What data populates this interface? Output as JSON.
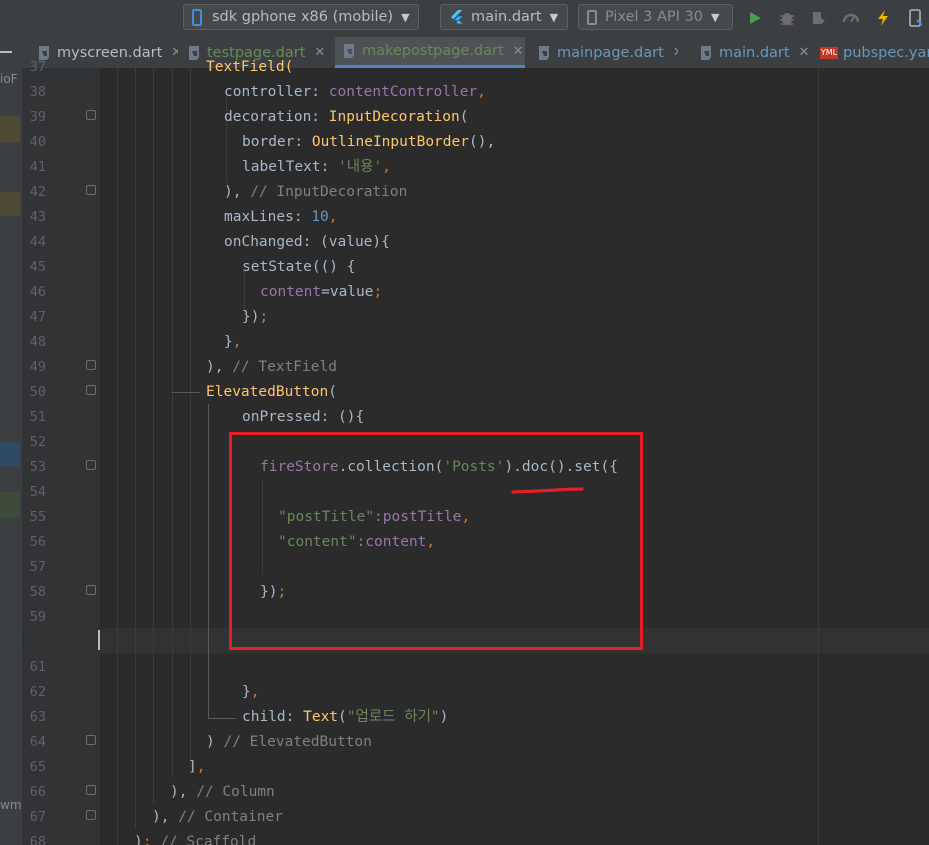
{
  "toolbar": {
    "device_selector": "sdk gphone x86 (mobile)",
    "run_config": "main.dart",
    "avd_selector": "Pixel 3 API 30",
    "icons": [
      "phone-icon",
      "flutter-icon",
      "device-icon",
      "run-icon",
      "debug-icon",
      "profile-icon",
      "coverage-icon",
      "hot-reload-icon",
      "device-manager-icon"
    ]
  },
  "tabs": [
    {
      "label": "myscreen.dart",
      "color": "#bbbbbb"
    },
    {
      "label": "testpage.dart",
      "color": "#6a8759"
    },
    {
      "label": "makepostpage.dart",
      "color": "#6a8759"
    },
    {
      "label": "mainpage.dart",
      "color": "#6897bb"
    },
    {
      "label": "main.dart",
      "color": "#6897bb"
    },
    {
      "label": "pubspec.yam",
      "color": "#6897bb"
    }
  ],
  "left_strip_labels": [
    "ioF",
    "wma"
  ],
  "line_numbers": [
    "37",
    "38",
    "39",
    "40",
    "41",
    "42",
    "43",
    "44",
    "45",
    "46",
    "47",
    "48",
    "49",
    "50",
    "51",
    "52",
    "53",
    "54",
    "55",
    "56",
    "57",
    "58",
    "59",
    "60",
    "61",
    "62",
    "63",
    "64",
    "65",
    "66",
    "67",
    "68"
  ],
  "current_line": "60",
  "code": {
    "l37": "TextField(",
    "l38_a": "controller: ",
    "l38_b": "contentController",
    "l38_c": ",",
    "l39_a": "decoration: ",
    "l39_b": "InputDecoration",
    "l39_c": "(",
    "l40_a": "border: ",
    "l40_b": "OutlineInputBorder",
    "l40_c": "(),",
    "l41_a": "labelText: ",
    "l41_b": "'내용'",
    "l41_c": ",",
    "l42_a": "), ",
    "l42_b": "// InputDecoration",
    "l43_a": "maxLines: ",
    "l43_b": "10",
    "l43_c": ",",
    "l44": "onChanged: (value){",
    "l45": "setState(() {",
    "l46_a": "content",
    "l46_b": "=value",
    "l46_c": ";",
    "l47_a": "})",
    "l47_b": ";",
    "l48_a": "}",
    "l48_b": ",",
    "l49_a": "), ",
    "l49_b": "// TextField",
    "l50_a": "ElevatedButton",
    "l50_b": "(",
    "l51": "onPressed: (){",
    "l53_a": "fireStore",
    "l53_b": ".collection(",
    "l53_c": "'Posts'",
    "l53_d": ").doc().set({",
    "l55_a": "\"postTitle\"",
    "l55_b": ":postTitle",
    "l55_c": ",",
    "l56_a": "\"content\"",
    "l56_b": ":content",
    "l56_c": ",",
    "l58_a": "})",
    "l58_b": ";",
    "l62_a": "}",
    "l62_b": ",",
    "l63_a": "child: ",
    "l63_b": "Text",
    "l63_c": "(",
    "l63_d": "\"업로드 하기\"",
    "l63_e": ")",
    "l64_a": ") ",
    "l64_b": "// ElevatedButton",
    "l65_a": "]",
    "l65_b": ",",
    "l66_a": "), ",
    "l66_b": "// Column",
    "l67_a": "), ",
    "l67_b": "// Container",
    "l68_a": ")",
    "l68_b": "; ",
    "l68_c": "// Scaffold"
  },
  "colors": {
    "annotation": "#e3202a",
    "keyword": "#cc7832",
    "field": "#9876aa",
    "class": "#ffc66d",
    "string": "#6a8759",
    "number": "#6897bb",
    "comment": "#808080"
  }
}
